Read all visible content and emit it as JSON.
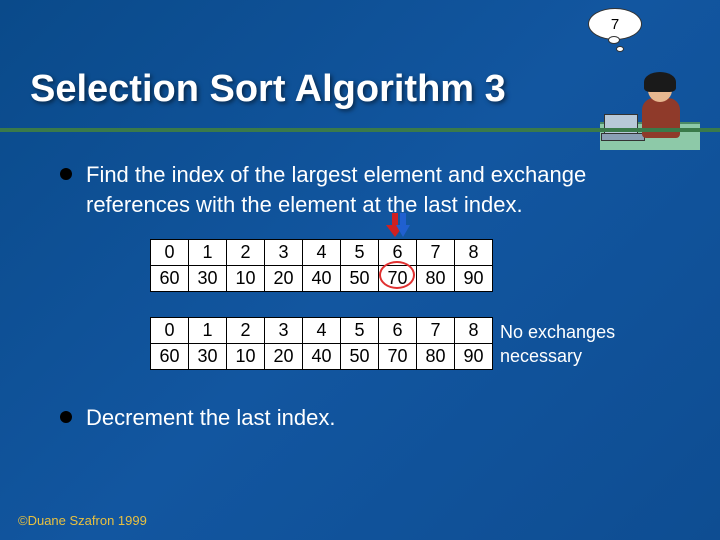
{
  "page_number": "7",
  "title": "Selection Sort Algorithm 3",
  "bullets": {
    "first": "Find the index of the largest element and exchange references with the element at the last index.",
    "second": "Decrement the last index."
  },
  "table1": {
    "indices": [
      "0",
      "1",
      "2",
      "3",
      "4",
      "5",
      "6",
      "7",
      "8"
    ],
    "values": [
      "60",
      "30",
      "10",
      "20",
      "40",
      "50",
      "70",
      "80",
      "90"
    ]
  },
  "table2": {
    "indices": [
      "0",
      "1",
      "2",
      "3",
      "4",
      "5",
      "6",
      "7",
      "8"
    ],
    "values": [
      "60",
      "30",
      "10",
      "20",
      "40",
      "50",
      "70",
      "80",
      "90"
    ]
  },
  "arrow_column": 6,
  "circle_column": 6,
  "note": "No exchanges necessary",
  "footer": "©Duane Szafron 1999"
}
